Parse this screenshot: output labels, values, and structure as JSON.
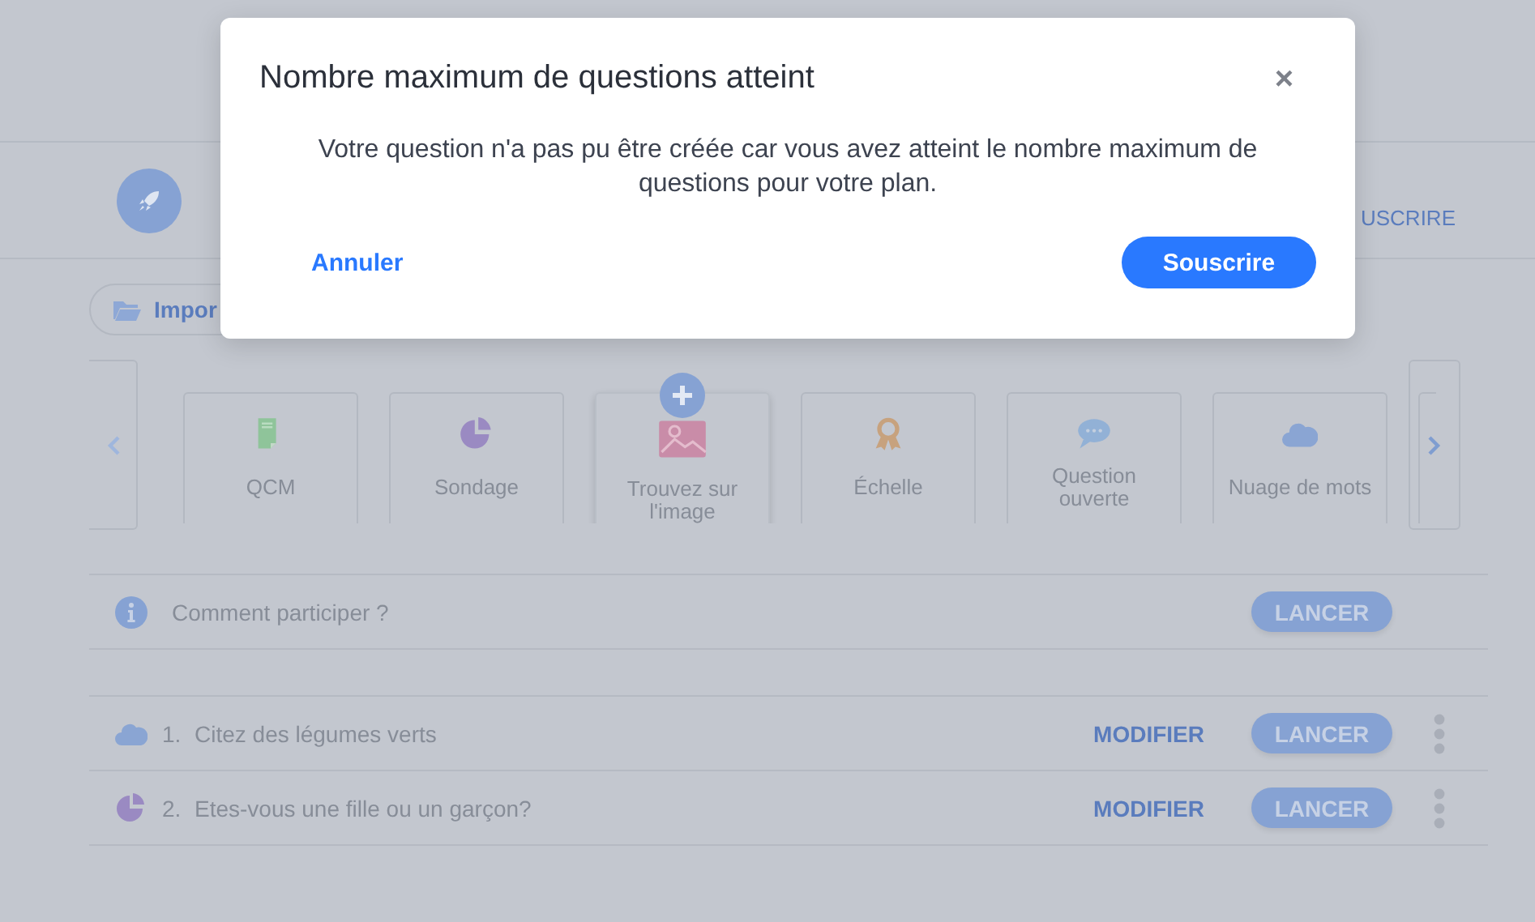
{
  "header": {
    "subscribe_link": "USCRIRE"
  },
  "import_button": {
    "label": "Impor"
  },
  "question_types": [
    {
      "label": "QCM",
      "kind": "document",
      "selected": false
    },
    {
      "label": "Sondage",
      "kind": "pie",
      "selected": false
    },
    {
      "label": "Trouvez sur l'image",
      "kind": "image",
      "selected": true
    },
    {
      "label": "Échelle",
      "kind": "ribbon",
      "selected": false
    },
    {
      "label": "Question ouverte",
      "kind": "chat",
      "selected": false
    },
    {
      "label": "Nuage de mots",
      "kind": "cloud",
      "selected": false
    }
  ],
  "info_row": {
    "text": "Comment participer ?",
    "launch": "LANCER"
  },
  "questions": [
    {
      "kind": "cloud",
      "number": "1.",
      "text": "Citez des légumes verts",
      "edit": "MODIFIER",
      "launch": "LANCER"
    },
    {
      "kind": "pie",
      "number": "2.",
      "text": "Etes-vous une fille ou un garçon?",
      "edit": "MODIFIER",
      "launch": "LANCER"
    }
  ],
  "dialog": {
    "title": "Nombre maximum de questions atteint",
    "close": "×",
    "message": "Votre question n'a pas pu être créée car vous avez atteint le nombre maximum de questions pour votre plan.",
    "cancel": "Annuler",
    "confirm": "Souscrire"
  }
}
